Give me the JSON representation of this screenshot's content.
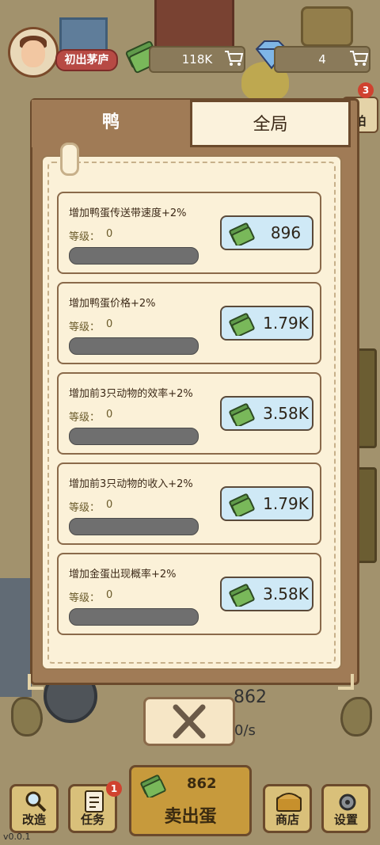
{
  "player": {
    "name": "初出茅庐"
  },
  "resources": {
    "cash": "118K",
    "gems": "4"
  },
  "side_badge": "3",
  "side_label": "拍",
  "tabs": [
    {
      "label": "鸭",
      "active": true
    },
    {
      "label": "全局",
      "active": false
    }
  ],
  "level_prefix": "等级：",
  "upgrades": [
    {
      "title": "增加鸭蛋传送带速度+2%",
      "level": "0",
      "price": "896",
      "progress": 0
    },
    {
      "title": "增加鸭蛋价格+2%",
      "level": "0",
      "price": "1.79K",
      "progress": 0
    },
    {
      "title": "增加前3只动物的效率+2%",
      "level": "0",
      "price": "3.58K",
      "progress": 0
    },
    {
      "title": "增加前3只动物的收入+2%",
      "level": "0",
      "price": "1.79K",
      "progress": 0
    },
    {
      "title": "增加金蛋出现概率+2%",
      "level": "0",
      "price": "3.58K",
      "progress": 0
    }
  ],
  "background": {
    "egg_count": "862",
    "rate": "0/s"
  },
  "bottom_bar": {
    "modify": "改造",
    "tasks": "任务",
    "tasks_badge": "1",
    "sell_count": "862",
    "sell_label": "卖出蛋",
    "shop": "商店",
    "settings": "设置"
  },
  "version": "v0.0.1",
  "colors": {
    "panel": "#a07b56",
    "paper": "#fbf1d8",
    "price_button": "#cfe9f6",
    "progress_track": "#6f6f6f",
    "sell_button": "#c79a3c"
  }
}
